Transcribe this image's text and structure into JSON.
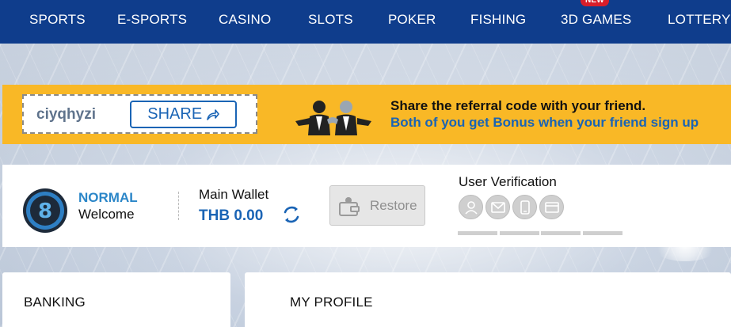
{
  "nav": {
    "items": [
      {
        "label": "SPORTS"
      },
      {
        "label": "E-SPORTS"
      },
      {
        "label": "CASINO"
      },
      {
        "label": "SLOTS"
      },
      {
        "label": "POKER"
      },
      {
        "label": "FISHING"
      },
      {
        "label": "3D GAMES",
        "badge": "NEW"
      },
      {
        "label": "LOTTERY"
      }
    ]
  },
  "referral": {
    "code": "ciyqhyzi",
    "share_label": "SHARE",
    "line1": "Share the referral code with your friend.",
    "line2": "Both of you get Bonus when your friend sign up"
  },
  "profile": {
    "level": "NORMAL",
    "welcome": "Welcome",
    "wallet_label": "Main Wallet",
    "wallet_amount": "THB 0.00",
    "restore_label": "Restore",
    "verification_title": "User Verification",
    "verification_icons": [
      "user-icon",
      "mail-icon",
      "phone-icon",
      "bank-card-icon"
    ]
  },
  "cards": {
    "banking": "BANKING",
    "my_profile": "MY PROFILE"
  },
  "colors": {
    "nav_bg": "#0f3d8c",
    "banner_bg": "#f9b826",
    "accent_blue": "#1a64b5",
    "level_blue": "#2b86c8",
    "badge_red": "#d81e2a"
  }
}
